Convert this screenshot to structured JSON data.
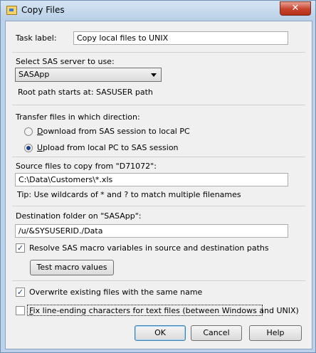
{
  "window": {
    "title": "Copy Files",
    "close_glyph": "✕"
  },
  "task": {
    "label": "Task label:",
    "value": "Copy local files to UNIX"
  },
  "server": {
    "label": "Select SAS server to use:",
    "selected": "SASApp",
    "root_path": "Root path starts at: SASUSER path"
  },
  "direction": {
    "label": "Transfer files in which direction:",
    "options": [
      {
        "mnemonic": "D",
        "rest": "ownload from SAS session to local PC",
        "checked": false
      },
      {
        "mnemonic": "U",
        "rest": "pload from local PC to SAS session",
        "checked": true
      }
    ]
  },
  "source": {
    "label": "Source files to copy from \"D71072\":",
    "value": "C:\\Data\\Customers\\*.xls",
    "tip": "Tip: Use wildcards of * and ? to match multiple filenames"
  },
  "destination": {
    "label": "Destination folder on \"SASApp\":",
    "value": "/u/&SYSUSERID./Data"
  },
  "options": {
    "resolve_macro": {
      "label": "Resolve SAS macro variables in source and destination paths",
      "checked": true
    },
    "test_macro_button": "Test macro values",
    "overwrite": {
      "label": "Overwrite existing files with the same name",
      "checked": true
    },
    "fix_line_endings": {
      "mnemonic": "F",
      "rest": "ix line-ending characters for text files (between Windows and UNIX)",
      "checked": false
    }
  },
  "buttons": {
    "ok": "OK",
    "cancel": "Cancel",
    "help": "Help"
  },
  "icons": {
    "check": "✓"
  }
}
